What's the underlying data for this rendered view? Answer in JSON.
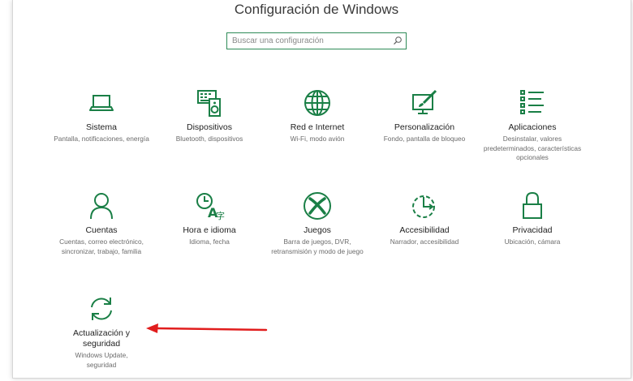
{
  "header": {
    "title": "Configuración de Windows"
  },
  "search": {
    "placeholder": "Buscar una configuración"
  },
  "colors": {
    "accent": "#1a7f46",
    "annotation_arrow": "#e11d1d"
  },
  "tiles": [
    {
      "label": "Sistema",
      "desc": "Pantalla, notificaciones, energía",
      "icon": "laptop-icon"
    },
    {
      "label": "Dispositivos",
      "desc": "Bluetooth, dispositivos",
      "icon": "devices-icon"
    },
    {
      "label": "Red e Internet",
      "desc": "Wi-Fi, modo avión",
      "icon": "globe-icon"
    },
    {
      "label": "Personalización",
      "desc": "Fondo, pantalla de bloqueo",
      "icon": "paint-icon"
    },
    {
      "label": "Aplicaciones",
      "desc": "Desinstalar, valores predeterminados, características opcionales",
      "icon": "apps-list-icon"
    },
    {
      "label": "Cuentas",
      "desc": "Cuentas, correo electrónico, sincronizar, trabajo, familia",
      "icon": "person-icon"
    },
    {
      "label": "Hora e idioma",
      "desc": "Idioma, fecha",
      "icon": "time-language-icon"
    },
    {
      "label": "Juegos",
      "desc": "Barra de juegos, DVR, retransmisión y modo de juego",
      "icon": "xbox-icon"
    },
    {
      "label": "Accesibilidad",
      "desc": "Narrador, accesibilidad",
      "icon": "accessibility-icon"
    },
    {
      "label": "Privacidad",
      "desc": "Ubicación, cámara",
      "icon": "lock-icon"
    },
    {
      "label": "Actualización y seguridad",
      "desc": "Windows Update, seguridad",
      "icon": "sync-icon"
    }
  ]
}
